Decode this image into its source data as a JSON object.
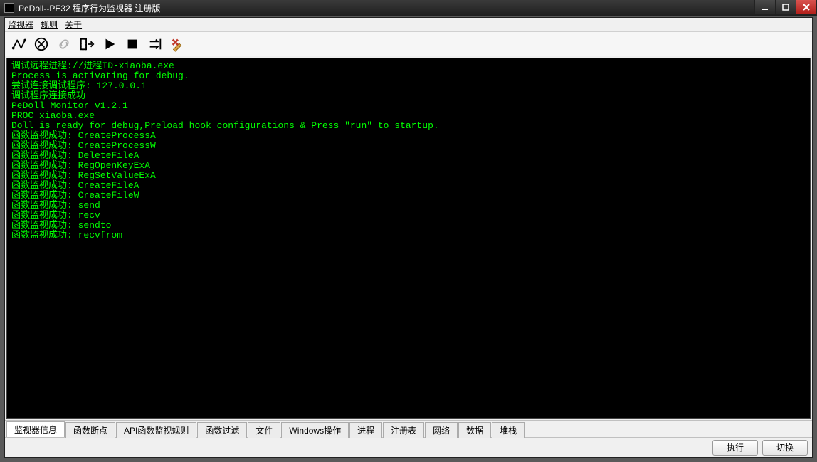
{
  "title": "PeDoll--PE32 程序行为监视器 注册版",
  "menu": {
    "monitor": "监视器",
    "rules": "规则",
    "about": "关于"
  },
  "toolbar_icons": {
    "debug": "debug-arrows-icon",
    "stop_debug": "circle-x-icon",
    "link": "chain-link-icon",
    "attach": "attach-process-icon",
    "run": "play-icon",
    "break": "stop-square-icon",
    "step": "step-arrows-icon",
    "clear": "brush-clear-icon"
  },
  "console_lines": [
    "调试远程进程://进程ID-xiaoba.exe",
    "Process is activating for debug.",
    "尝试连接调试程序: 127.0.0.1",
    "调试程序连接成功",
    "PeDoll Monitor v1.2.1",
    "PROC xiaoba.exe",
    "Doll is ready for debug,Preload hook configurations & Press \"run\" to startup.",
    "函数监视成功: CreateProcessA",
    "函数监视成功: CreateProcessW",
    "函数监视成功: DeleteFileA",
    "函数监视成功: RegOpenKeyExA",
    "函数监视成功: RegSetValueExA",
    "函数监视成功: CreateFileA",
    "函数监视成功: CreateFileW",
    "函数监视成功: send",
    "函数监视成功: recv",
    "函数监视成功: sendto",
    "函数监视成功: recvfrom"
  ],
  "tabs": {
    "t0": "监视器信息",
    "t1": "函数断点",
    "t2": "API函数监视规则",
    "t3": "函数过滤",
    "t4": "文件",
    "t5": "Windows操作",
    "t6": "进程",
    "t7": "注册表",
    "t8": "网络",
    "t9": "数据",
    "t10": "堆栈"
  },
  "buttons": {
    "execute": "执行",
    "switch": "切换"
  }
}
